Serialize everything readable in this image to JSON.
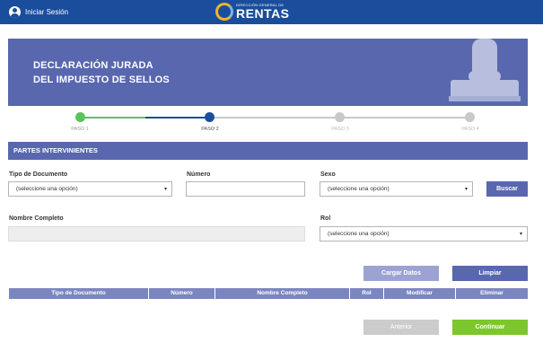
{
  "header": {
    "login_label": "Iniciar Sesión",
    "logo_subtitle": "DIRECCIÓN GENERAL DE",
    "logo_title": "RENTAS"
  },
  "hero": {
    "title_line1": "DECLARACIÓN JURADA",
    "title_line2": "DEL IMPUESTO DE SELLOS"
  },
  "stepper": {
    "steps": [
      {
        "label": "PASO 1",
        "state": "completed",
        "color": "#5cc35c"
      },
      {
        "label": "PASO 2",
        "state": "current",
        "color": "#1a4e9c"
      },
      {
        "label": "PASO 3",
        "state": "pending",
        "color": "#c8c8c8"
      },
      {
        "label": "PASO 4",
        "state": "pending",
        "color": "#c8c8c8"
      }
    ]
  },
  "section": {
    "title": "PARTES INTERVINIENTES"
  },
  "form": {
    "tipo_documento": {
      "label": "Tipo de Documento",
      "value": "(seleccione una opción)"
    },
    "numero": {
      "label": "Número",
      "value": ""
    },
    "sexo": {
      "label": "Sexo",
      "value": "(seleccione una opción)"
    },
    "buscar_label": "Buscar",
    "nombre_completo": {
      "label": "Nombre Completo",
      "value": ""
    },
    "rol": {
      "label": "Rol",
      "value": "(seleccione una opción)"
    }
  },
  "actions": {
    "cargar_datos": "Cargar Datos",
    "limpiar": "Limpiar",
    "anterior": "Anterior",
    "continuar": "Continuar"
  },
  "table": {
    "columns": [
      "Tipo de Documento",
      "Número",
      "Nombre Completo",
      "Rol",
      "Modificar",
      "Eliminar"
    ]
  },
  "colors": {
    "topbar": "#1a4e9c",
    "primary": "#5867ae",
    "primary_light": "#9ca3d3",
    "success": "#7cc72c",
    "disabled": "#cccccc"
  }
}
